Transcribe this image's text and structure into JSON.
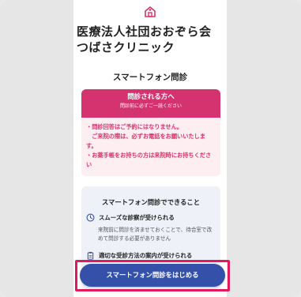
{
  "header": {
    "clinic_name": "医療法人社団おおぞら会　つばさクリニック",
    "page_title": "スマートフォン問診"
  },
  "notice": {
    "title": "問診される方へ",
    "subtitle": "問診前に必ずご一読ください",
    "lines": [
      "・問診回答はご予約にはなりません。",
      "　ご来院の際は、必ずお電話をお願いいたします。",
      "・お薬手帳をお持ちの方は来院時にお持ちください"
    ]
  },
  "features": {
    "title": "スマートフォン問診でできること",
    "items": [
      {
        "heading": "スムーズな診察が受けられる",
        "description": "来院前に問診を済ませておくことで、待合室で改めて問診する必要がありません"
      },
      {
        "heading": "適切な受診方法の案内が受けられる",
        "description": ""
      }
    ]
  },
  "cta": {
    "label": "スマートフォン問診をはじめる"
  },
  "colors": {
    "accent_pink": "#d4336f",
    "notice_bg": "#fdeef2",
    "button_blue": "#3550a8",
    "highlight": "#e3195f"
  }
}
